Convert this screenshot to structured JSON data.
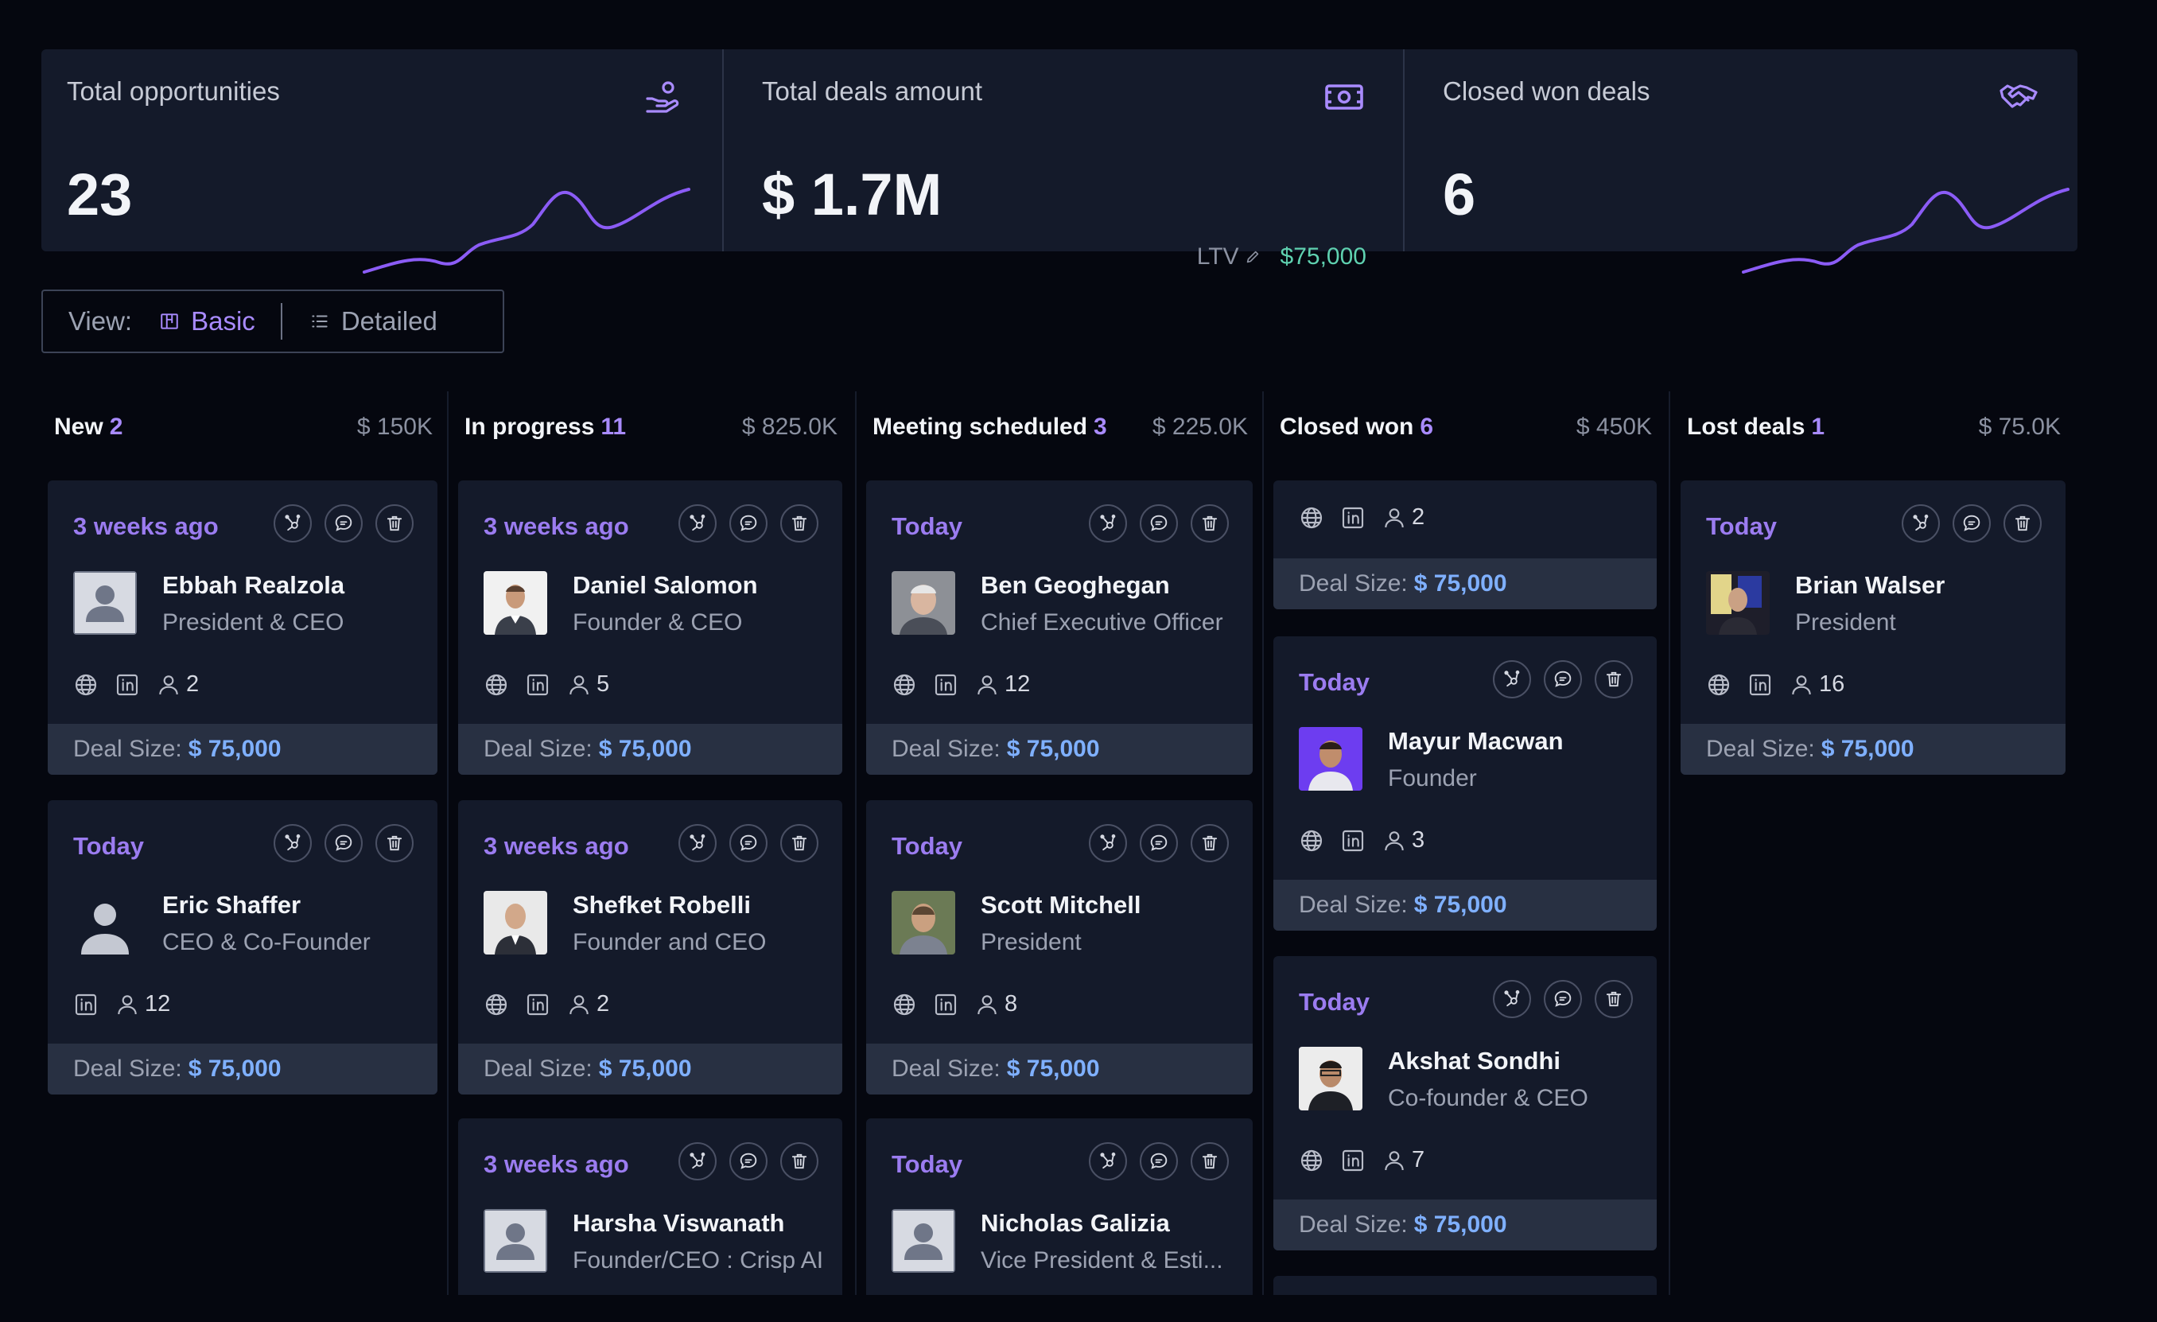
{
  "stats": {
    "total_opportunities": {
      "title": "Total opportunities",
      "value": "23",
      "icon": "hand-coins-icon"
    },
    "total_deals": {
      "title": "Total deals amount",
      "value": "$ 1.7M",
      "icon": "cash-icon",
      "ltv_label": "LTV",
      "ltv_value": "$75,000"
    },
    "closed_won": {
      "title": "Closed won deals",
      "value": "6",
      "icon": "handshake-icon"
    }
  },
  "view": {
    "label": "View:",
    "basic": "Basic",
    "detailed": "Detailed"
  },
  "columns": [
    {
      "title": "New",
      "count": "2",
      "amount": "$ 150K"
    },
    {
      "title": "In progress",
      "count": "11",
      "amount": "$ 825.0K"
    },
    {
      "title": "Meeting scheduled",
      "count": "3",
      "amount": "$ 225.0K"
    },
    {
      "title": "Closed won",
      "count": "6",
      "amount": "$ 450K"
    },
    {
      "title": "Lost deals",
      "count": "1",
      "amount": "$ 75.0K"
    }
  ],
  "deal_label": "Deal Size:",
  "cards": {
    "c0_0": {
      "time": "3 weeks ago",
      "name": "Ebbah Realzola",
      "role": "President & CEO",
      "count": "2",
      "deal": "$ 75,000"
    },
    "c0_1": {
      "time": "Today",
      "name": "Eric Shaffer",
      "role": "CEO & Co-Founder",
      "count": "12",
      "deal": "$ 75,000"
    },
    "c1_0": {
      "time": "3 weeks ago",
      "name": "Daniel Salomon",
      "role": "Founder & CEO",
      "count": "5",
      "deal": "$ 75,000"
    },
    "c1_1": {
      "time": "3 weeks ago",
      "name": "Shefket Robelli",
      "role": "Founder and CEO",
      "count": "2",
      "deal": "$ 75,000"
    },
    "c1_2": {
      "time": "3 weeks ago",
      "name": "Harsha Viswanath",
      "role": "Founder/CEO : Crisp AI"
    },
    "c2_0": {
      "time": "Today",
      "name": "Ben Geoghegan",
      "role": "Chief Executive Officer",
      "count": "12",
      "deal": "$ 75,000"
    },
    "c2_1": {
      "time": "Today",
      "name": "Scott Mitchell",
      "role": "President",
      "count": "8",
      "deal": "$ 75,000"
    },
    "c2_2": {
      "time": "Today",
      "name": "Nicholas Galizia",
      "role": "Vice President & Esti..."
    },
    "c3_0": {
      "count": "2",
      "deal": "$ 75,000"
    },
    "c3_1": {
      "time": "Today",
      "name": "Mayur Macwan",
      "role": "Founder",
      "count": "3",
      "deal": "$ 75,000"
    },
    "c3_2": {
      "time": "Today",
      "name": "Akshat Sondhi",
      "role": "Co-founder & CEO",
      "count": "7",
      "deal": "$ 75,000"
    },
    "c4_0": {
      "time": "Today",
      "name": "Brian Walser",
      "role": "President",
      "count": "16",
      "deal": "$ 75,000"
    }
  },
  "colors": {
    "accent": "#a98bff",
    "time": "#9b7cf0",
    "deal_value": "#7fb0ff",
    "ltv_value": "#5fd1b0",
    "card_bg": "#141a2a"
  }
}
